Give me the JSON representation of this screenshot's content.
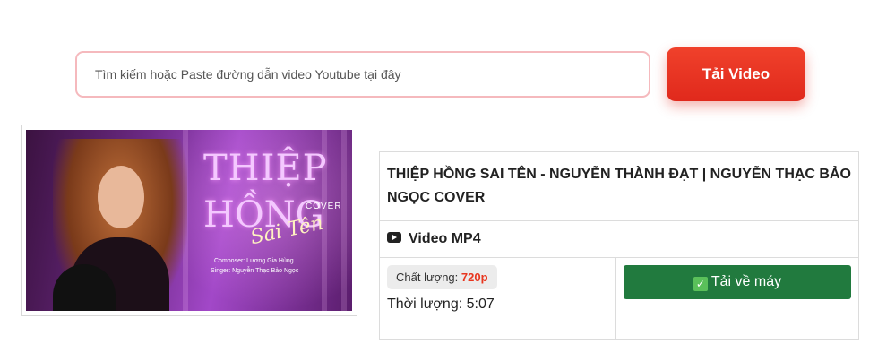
{
  "search": {
    "placeholder": "Tìm kiếm hoặc Paste đường dẫn video Youtube tại đây",
    "button_label": "Tải Video"
  },
  "video": {
    "thumbnail": {
      "title_line1": "THIỆP",
      "title_line2": "HỒNG",
      "cover_tag": "COVER",
      "script_text": "Sai Tên",
      "composer": "Composer: Lương Gia Hùng",
      "singer": "Singer: Nguyễn Thạc Bảo Ngọc"
    },
    "title": "THIỆP HỒNG SAI TÊN - NGUYỄN THÀNH ĐẠT | NGUYỄN THẠC BẢO NGỌC COVER",
    "format_icon": "youtube-icon",
    "format_label": "Video MP4",
    "quality_label": "Chất lượng:",
    "quality_value": "720p",
    "duration_label": "Thời lượng: 5:07",
    "save_label": "Tải về máy"
  },
  "colors": {
    "primary_button": "#e8361f",
    "save_button": "#217a3e",
    "input_border": "#f5b9bd"
  }
}
